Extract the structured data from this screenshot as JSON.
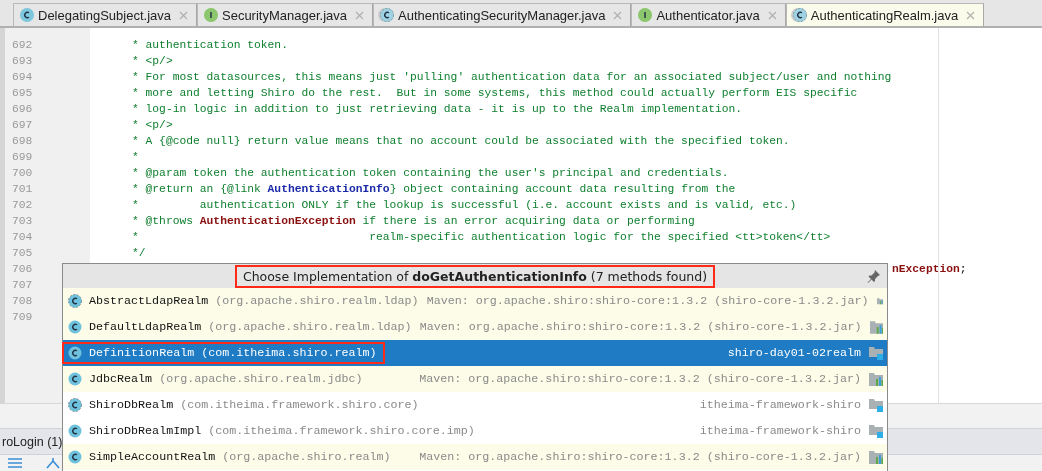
{
  "tabs": [
    {
      "label": "DelegatingSubject.java",
      "kind": "class",
      "selected": false
    },
    {
      "label": "SecurityManager.java",
      "kind": "interface",
      "selected": false
    },
    {
      "label": "AuthenticatingSecurityManager.java",
      "kind": "abstract_class",
      "selected": false
    },
    {
      "label": "Authenticator.java",
      "kind": "interface",
      "selected": false
    },
    {
      "label": "AuthenticatingRealm.java",
      "kind": "abstract_class",
      "selected": true
    }
  ],
  "editor": {
    "lines": [
      {
        "number": "692",
        "covered": false,
        "segments": [
          {
            "text": "* authentication token.",
            "kind": "comment"
          }
        ]
      },
      {
        "number": "693",
        "covered": false,
        "segments": [
          {
            "text": "* <p/>",
            "kind": "comment"
          }
        ]
      },
      {
        "number": "694",
        "covered": false,
        "segments": [
          {
            "text": "* For most datasources, this means just 'pulling' authentication data for an associated subject/user and nothing",
            "kind": "comment"
          }
        ]
      },
      {
        "number": "695",
        "covered": false,
        "segments": [
          {
            "text": "* more and letting Shiro do the rest.  But in some systems, this method could actually perform EIS specific",
            "kind": "comment"
          }
        ]
      },
      {
        "number": "696",
        "covered": false,
        "segments": [
          {
            "text": "* log-in logic in addition to just retrieving data - it is up to the Realm implementation.",
            "kind": "comment"
          }
        ]
      },
      {
        "number": "697",
        "covered": false,
        "segments": [
          {
            "text": "* <p/>",
            "kind": "comment"
          }
        ]
      },
      {
        "number": "698",
        "covered": false,
        "segments": [
          {
            "text": "* A {@code null} return value means that no account could be associated with the specified token.",
            "kind": "comment"
          }
        ]
      },
      {
        "number": "699",
        "covered": false,
        "segments": [
          {
            "text": "*",
            "kind": "comment"
          }
        ]
      },
      {
        "number": "700",
        "covered": false,
        "segments": [
          {
            "text": "* @param token the authentication token containing the user's principal and credentials.",
            "kind": "comment"
          }
        ]
      },
      {
        "number": "701",
        "covered": false,
        "segments": [
          {
            "text": "* @return an {@link ",
            "kind": "comment"
          },
          {
            "text": "AuthenticationInfo",
            "kind": "link"
          },
          {
            "text": "} object containing account data resulting from the",
            "kind": "comment"
          }
        ]
      },
      {
        "number": "702",
        "covered": false,
        "segments": [
          {
            "text": "*         authentication ONLY if the lookup is successful (i.e. account exists and is valid, etc.)",
            "kind": "comment"
          }
        ]
      },
      {
        "number": "703",
        "covered": false,
        "segments": [
          {
            "text": "* @throws ",
            "kind": "comment"
          },
          {
            "text": "AuthenticationException",
            "kind": "exception"
          },
          {
            "text": " if there is an error acquiring data or performing",
            "kind": "comment"
          }
        ]
      },
      {
        "number": "704",
        "covered": false,
        "segments": [
          {
            "text": "*                                  realm-specific authentication logic for the specified <tt>token</tt>",
            "kind": "comment"
          }
        ]
      },
      {
        "number": "705",
        "covered": false,
        "segments": [
          {
            "text": "*/",
            "kind": "comment"
          }
        ]
      },
      {
        "number": "706",
        "covered": true,
        "segments": [
          {
            "text": "nException",
            "kind": "exception"
          },
          {
            "text": ";",
            "kind": "plain"
          }
        ]
      },
      {
        "number": "707"
      },
      {
        "number": "708"
      },
      {
        "number": "709"
      }
    ]
  },
  "popup": {
    "title_prefix": "Choose Implementation of",
    "method": "doGetAuthenticationInfo",
    "count": "(7 methods found)",
    "title_annotated": true,
    "items": [
      {
        "name": "AbstractLdapRealm",
        "package": "(org.apache.shiro.realm.ldap)",
        "location": "Maven: org.apache.shiro:shiro-core:1.3.2 (shiro-core-1.3.2.jar)",
        "kind": "library",
        "abstract": true,
        "selected": false,
        "annotated": false
      },
      {
        "name": "DefaultLdapRealm",
        "package": "(org.apache.shiro.realm.ldap)",
        "location": "Maven: org.apache.shiro:shiro-core:1.3.2 (shiro-core-1.3.2.jar)",
        "kind": "library",
        "abstract": false,
        "selected": false,
        "annotated": false
      },
      {
        "name": "DefinitionRealm",
        "package": "(com.itheima.shiro.realm)",
        "location": "shiro-day01-02realm",
        "kind": "module",
        "abstract": false,
        "selected": true,
        "annotated": true
      },
      {
        "name": "JdbcRealm",
        "package": "(org.apache.shiro.realm.jdbc)",
        "location": "Maven: org.apache.shiro:shiro-core:1.3.2 (shiro-core-1.3.2.jar)",
        "kind": "library",
        "abstract": false,
        "selected": false,
        "annotated": false
      },
      {
        "name": "ShiroDbRealm",
        "package": "(com.itheima.framework.shiro.core)",
        "location": "itheima-framework-shiro",
        "kind": "module",
        "abstract": true,
        "selected": false,
        "annotated": false
      },
      {
        "name": "ShiroDbRealmImpl",
        "package": "(com.itheima.framework.shiro.core.imp)",
        "location": "itheima-framework-shiro",
        "kind": "module",
        "abstract": false,
        "selected": false,
        "annotated": false
      },
      {
        "name": "SimpleAccountRealm",
        "package": "(org.apache.shiro.realm)",
        "location": "Maven: org.apache.shiro:shiro-core:1.3.2 (shiro-core-1.3.2.jar)",
        "kind": "library",
        "abstract": false,
        "selected": false,
        "annotated": false
      }
    ]
  },
  "bottom_panel": {
    "tab": "roLogin (1)"
  }
}
